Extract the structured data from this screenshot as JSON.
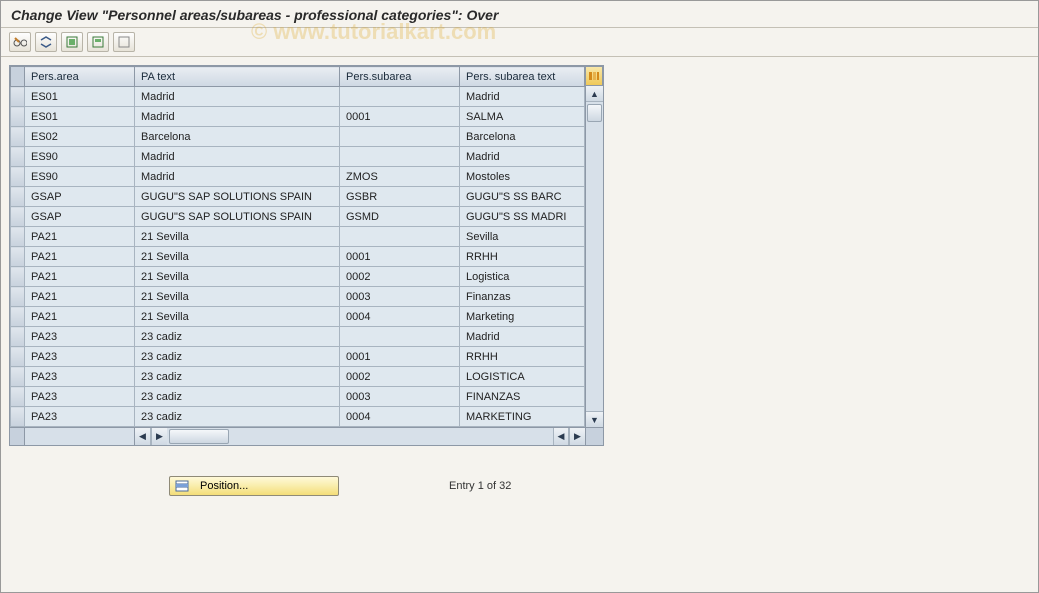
{
  "title": "Change View \"Personnel areas/subareas - professional categories\": Over",
  "watermark": "© www.tutorialkart.com",
  "toolbar": {
    "glasses": "display-change-toggle",
    "expand": "expand-all",
    "select_all": "select-all",
    "select_block": "select-block",
    "deselect_all": "deselect-all"
  },
  "table": {
    "headers": {
      "pers_area": "Pers.area",
      "pa_text": "PA text",
      "pers_subarea": "Pers.subarea",
      "pers_subarea_text": "Pers. subarea text"
    },
    "rows": [
      {
        "pers_area": "ES01",
        "pa_text": "Madrid",
        "pers_subarea": "",
        "pers_subarea_text": "Madrid"
      },
      {
        "pers_area": "ES01",
        "pa_text": "Madrid",
        "pers_subarea": "0001",
        "pers_subarea_text": "SALMA"
      },
      {
        "pers_area": "ES02",
        "pa_text": "Barcelona",
        "pers_subarea": "",
        "pers_subarea_text": "Barcelona"
      },
      {
        "pers_area": "ES90",
        "pa_text": "Madrid",
        "pers_subarea": "",
        "pers_subarea_text": "Madrid"
      },
      {
        "pers_area": "ES90",
        "pa_text": "Madrid",
        "pers_subarea": "ZMOS",
        "pers_subarea_text": "Mostoles"
      },
      {
        "pers_area": "GSAP",
        "pa_text": "GUGU\"S SAP SOLUTIONS SPAIN",
        "pers_subarea": "GSBR",
        "pers_subarea_text": "GUGU\"S SS BARC"
      },
      {
        "pers_area": "GSAP",
        "pa_text": "GUGU\"S SAP SOLUTIONS SPAIN",
        "pers_subarea": "GSMD",
        "pers_subarea_text": "GUGU\"S SS MADRI"
      },
      {
        "pers_area": "PA21",
        "pa_text": "21 Sevilla",
        "pers_subarea": "",
        "pers_subarea_text": "Sevilla"
      },
      {
        "pers_area": "PA21",
        "pa_text": "21 Sevilla",
        "pers_subarea": "0001",
        "pers_subarea_text": "RRHH"
      },
      {
        "pers_area": "PA21",
        "pa_text": "21 Sevilla",
        "pers_subarea": "0002",
        "pers_subarea_text": "Logistica"
      },
      {
        "pers_area": "PA21",
        "pa_text": "21 Sevilla",
        "pers_subarea": "0003",
        "pers_subarea_text": "Finanzas"
      },
      {
        "pers_area": "PA21",
        "pa_text": "21 Sevilla",
        "pers_subarea": "0004",
        "pers_subarea_text": "Marketing"
      },
      {
        "pers_area": "PA23",
        "pa_text": "23 cadiz",
        "pers_subarea": "",
        "pers_subarea_text": "Madrid"
      },
      {
        "pers_area": "PA23",
        "pa_text": "23 cadiz",
        "pers_subarea": "0001",
        "pers_subarea_text": "RRHH"
      },
      {
        "pers_area": "PA23",
        "pa_text": "23 cadiz",
        "pers_subarea": "0002",
        "pers_subarea_text": "LOGISTICA"
      },
      {
        "pers_area": "PA23",
        "pa_text": "23 cadiz",
        "pers_subarea": "0003",
        "pers_subarea_text": "FINANZAS"
      },
      {
        "pers_area": "PA23",
        "pa_text": "23 cadiz",
        "pers_subarea": "0004",
        "pers_subarea_text": "MARKETING"
      }
    ]
  },
  "footer": {
    "position_label": "Position...",
    "entry_text": "Entry 1 of 32"
  },
  "colors": {
    "header_bg": "#ced8e3",
    "cell_bg": "#dfe8ef",
    "app_bg": "#f5f3ee"
  }
}
